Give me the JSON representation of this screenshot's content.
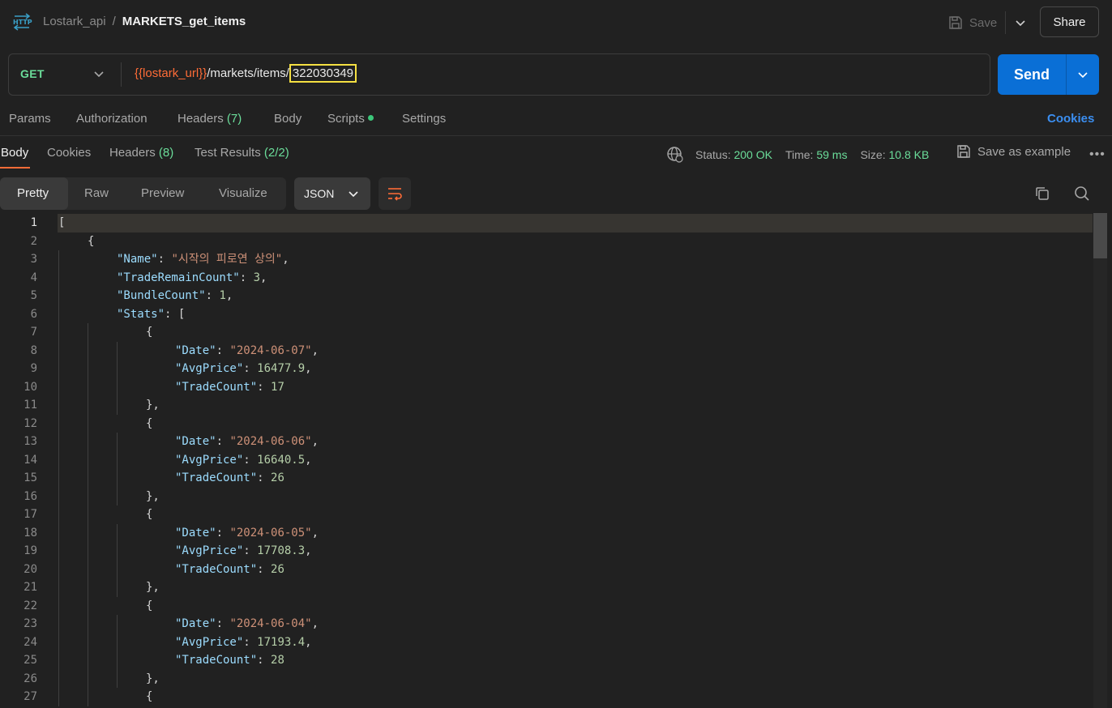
{
  "header": {
    "collection": "Lostark_api",
    "separator": "/",
    "request_name": "MARKETS_get_items",
    "save_label": "Save",
    "share_label": "Share"
  },
  "request": {
    "method": "GET",
    "url_variable": "{{lostark_url}}",
    "url_path": "/markets/items/",
    "url_id": "322030349",
    "send_label": "Send"
  },
  "request_tabs": {
    "params": "Params",
    "authorization": "Authorization",
    "headers": "Headers",
    "headers_count": "(7)",
    "body": "Body",
    "scripts": "Scripts",
    "settings": "Settings",
    "cookies": "Cookies"
  },
  "response_tabs": {
    "body": "Body",
    "cookies": "Cookies",
    "headers": "Headers",
    "headers_count": "(8)",
    "test_results": "Test Results",
    "test_results_count": "(2/2)"
  },
  "status": {
    "status_label": "Status:",
    "status_value": "200 OK",
    "time_label": "Time:",
    "time_value": "59 ms",
    "size_label": "Size:",
    "size_value": "10.8 KB",
    "save_example": "Save as example"
  },
  "viewer": {
    "pretty": "Pretty",
    "raw": "Raw",
    "preview": "Preview",
    "visualize": "Visualize",
    "format": "JSON"
  },
  "code_lines": [
    {
      "n": "1",
      "indent": 0,
      "parts": [
        [
          "p",
          "["
        ]
      ]
    },
    {
      "n": "2",
      "indent": 1,
      "parts": [
        [
          "p",
          "{"
        ]
      ]
    },
    {
      "n": "3",
      "indent": 2,
      "parts": [
        [
          "k",
          "\"Name\""
        ],
        [
          "p",
          ": "
        ],
        [
          "s",
          "\"시작의 피로연 상의\""
        ],
        [
          "p",
          ","
        ]
      ]
    },
    {
      "n": "4",
      "indent": 2,
      "parts": [
        [
          "k",
          "\"TradeRemainCount\""
        ],
        [
          "p",
          ": "
        ],
        [
          "n",
          "3"
        ],
        [
          "p",
          ","
        ]
      ]
    },
    {
      "n": "5",
      "indent": 2,
      "parts": [
        [
          "k",
          "\"BundleCount\""
        ],
        [
          "p",
          ": "
        ],
        [
          "n",
          "1"
        ],
        [
          "p",
          ","
        ]
      ]
    },
    {
      "n": "6",
      "indent": 2,
      "parts": [
        [
          "k",
          "\"Stats\""
        ],
        [
          "p",
          ": ["
        ]
      ]
    },
    {
      "n": "7",
      "indent": 3,
      "parts": [
        [
          "p",
          "{"
        ]
      ]
    },
    {
      "n": "8",
      "indent": 4,
      "parts": [
        [
          "k",
          "\"Date\""
        ],
        [
          "p",
          ": "
        ],
        [
          "s",
          "\"2024-06-07\""
        ],
        [
          "p",
          ","
        ]
      ]
    },
    {
      "n": "9",
      "indent": 4,
      "parts": [
        [
          "k",
          "\"AvgPrice\""
        ],
        [
          "p",
          ": "
        ],
        [
          "n",
          "16477.9"
        ],
        [
          "p",
          ","
        ]
      ]
    },
    {
      "n": "10",
      "indent": 4,
      "parts": [
        [
          "k",
          "\"TradeCount\""
        ],
        [
          "p",
          ": "
        ],
        [
          "n",
          "17"
        ]
      ]
    },
    {
      "n": "11",
      "indent": 3,
      "parts": [
        [
          "p",
          "},"
        ]
      ]
    },
    {
      "n": "12",
      "indent": 3,
      "parts": [
        [
          "p",
          "{"
        ]
      ]
    },
    {
      "n": "13",
      "indent": 4,
      "parts": [
        [
          "k",
          "\"Date\""
        ],
        [
          "p",
          ": "
        ],
        [
          "s",
          "\"2024-06-06\""
        ],
        [
          "p",
          ","
        ]
      ]
    },
    {
      "n": "14",
      "indent": 4,
      "parts": [
        [
          "k",
          "\"AvgPrice\""
        ],
        [
          "p",
          ": "
        ],
        [
          "n",
          "16640.5"
        ],
        [
          "p",
          ","
        ]
      ]
    },
    {
      "n": "15",
      "indent": 4,
      "parts": [
        [
          "k",
          "\"TradeCount\""
        ],
        [
          "p",
          ": "
        ],
        [
          "n",
          "26"
        ]
      ]
    },
    {
      "n": "16",
      "indent": 3,
      "parts": [
        [
          "p",
          "},"
        ]
      ]
    },
    {
      "n": "17",
      "indent": 3,
      "parts": [
        [
          "p",
          "{"
        ]
      ]
    },
    {
      "n": "18",
      "indent": 4,
      "parts": [
        [
          "k",
          "\"Date\""
        ],
        [
          "p",
          ": "
        ],
        [
          "s",
          "\"2024-06-05\""
        ],
        [
          "p",
          ","
        ]
      ]
    },
    {
      "n": "19",
      "indent": 4,
      "parts": [
        [
          "k",
          "\"AvgPrice\""
        ],
        [
          "p",
          ": "
        ],
        [
          "n",
          "17708.3"
        ],
        [
          "p",
          ","
        ]
      ]
    },
    {
      "n": "20",
      "indent": 4,
      "parts": [
        [
          "k",
          "\"TradeCount\""
        ],
        [
          "p",
          ": "
        ],
        [
          "n",
          "26"
        ]
      ]
    },
    {
      "n": "21",
      "indent": 3,
      "parts": [
        [
          "p",
          "},"
        ]
      ]
    },
    {
      "n": "22",
      "indent": 3,
      "parts": [
        [
          "p",
          "{"
        ]
      ]
    },
    {
      "n": "23",
      "indent": 4,
      "parts": [
        [
          "k",
          "\"Date\""
        ],
        [
          "p",
          ": "
        ],
        [
          "s",
          "\"2024-06-04\""
        ],
        [
          "p",
          ","
        ]
      ]
    },
    {
      "n": "24",
      "indent": 4,
      "parts": [
        [
          "k",
          "\"AvgPrice\""
        ],
        [
          "p",
          ": "
        ],
        [
          "n",
          "17193.4"
        ],
        [
          "p",
          ","
        ]
      ]
    },
    {
      "n": "25",
      "indent": 4,
      "parts": [
        [
          "k",
          "\"TradeCount\""
        ],
        [
          "p",
          ": "
        ],
        [
          "n",
          "28"
        ]
      ]
    },
    {
      "n": "26",
      "indent": 3,
      "parts": [
        [
          "p",
          "},"
        ]
      ]
    },
    {
      "n": "27",
      "indent": 3,
      "parts": [
        [
          "p",
          "{"
        ]
      ]
    }
  ]
}
